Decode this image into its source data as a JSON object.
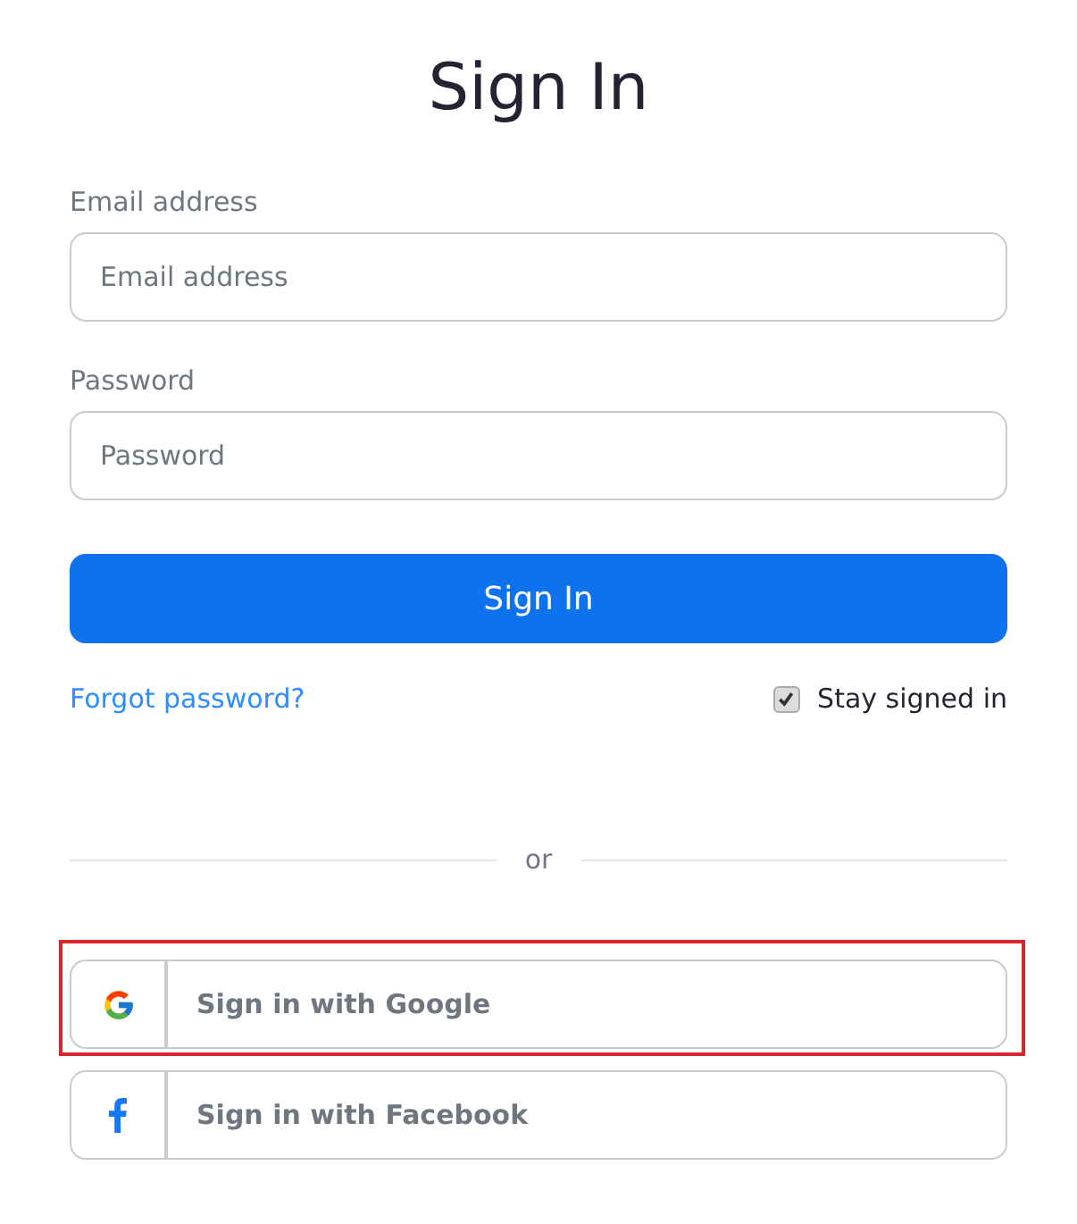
{
  "title": "Sign In",
  "fields": [
    {
      "label": "Email address",
      "placeholder": "Email address"
    },
    {
      "label": "Password",
      "placeholder": "Password"
    }
  ],
  "submit": "Sign In",
  "forgot_link": "Forgot password?",
  "stay_signed_in": {
    "label": "Stay signed in",
    "checked": true
  },
  "divider": "or",
  "social_buttons": [
    {
      "kind": "google",
      "label": "Sign in with Google",
      "highlighted": true
    },
    {
      "kind": "facebook",
      "label": "Sign in with Facebook",
      "highlighted": false
    }
  ]
}
